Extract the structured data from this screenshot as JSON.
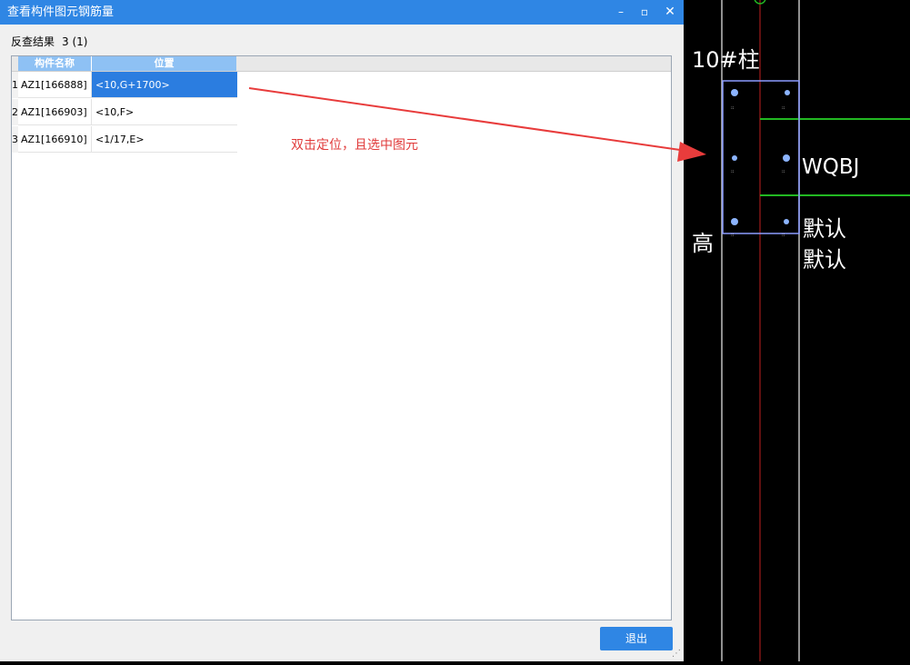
{
  "dialog": {
    "title": "查看构件图元钢筋量",
    "buttons": {
      "minimize": "–",
      "maximize": "▫",
      "close": "✕"
    },
    "result_label": "反查结果",
    "result_count": "3 (1)",
    "columns": [
      "构件名称",
      "位置"
    ],
    "rows": [
      {
        "num": "1",
        "name": "AZ1[166888]",
        "pos": "<10,G+1700>"
      },
      {
        "num": "2",
        "name": "AZ1[166903]",
        "pos": "<10,F>"
      },
      {
        "num": "3",
        "name": "AZ1[166910]",
        "pos": "<1/17,E>"
      }
    ],
    "exit_label": "退出"
  },
  "annotation": {
    "text": "双击定位，且选中图元",
    "color": "#e03a3a"
  },
  "cad": {
    "labels": {
      "column_name": "10#柱",
      "code": "WQBJ",
      "default1": "默认",
      "default2": "默认",
      "height": "高"
    },
    "colors": {
      "grid_line": "#c0c0c0",
      "axis_red": "#c02020",
      "green": "#22b822",
      "column_outline": "#8c9cff"
    }
  },
  "colors": {
    "title_bar": "#2f86e4",
    "selected_row": "#2b7de0",
    "header": "#8ec1f4"
  }
}
